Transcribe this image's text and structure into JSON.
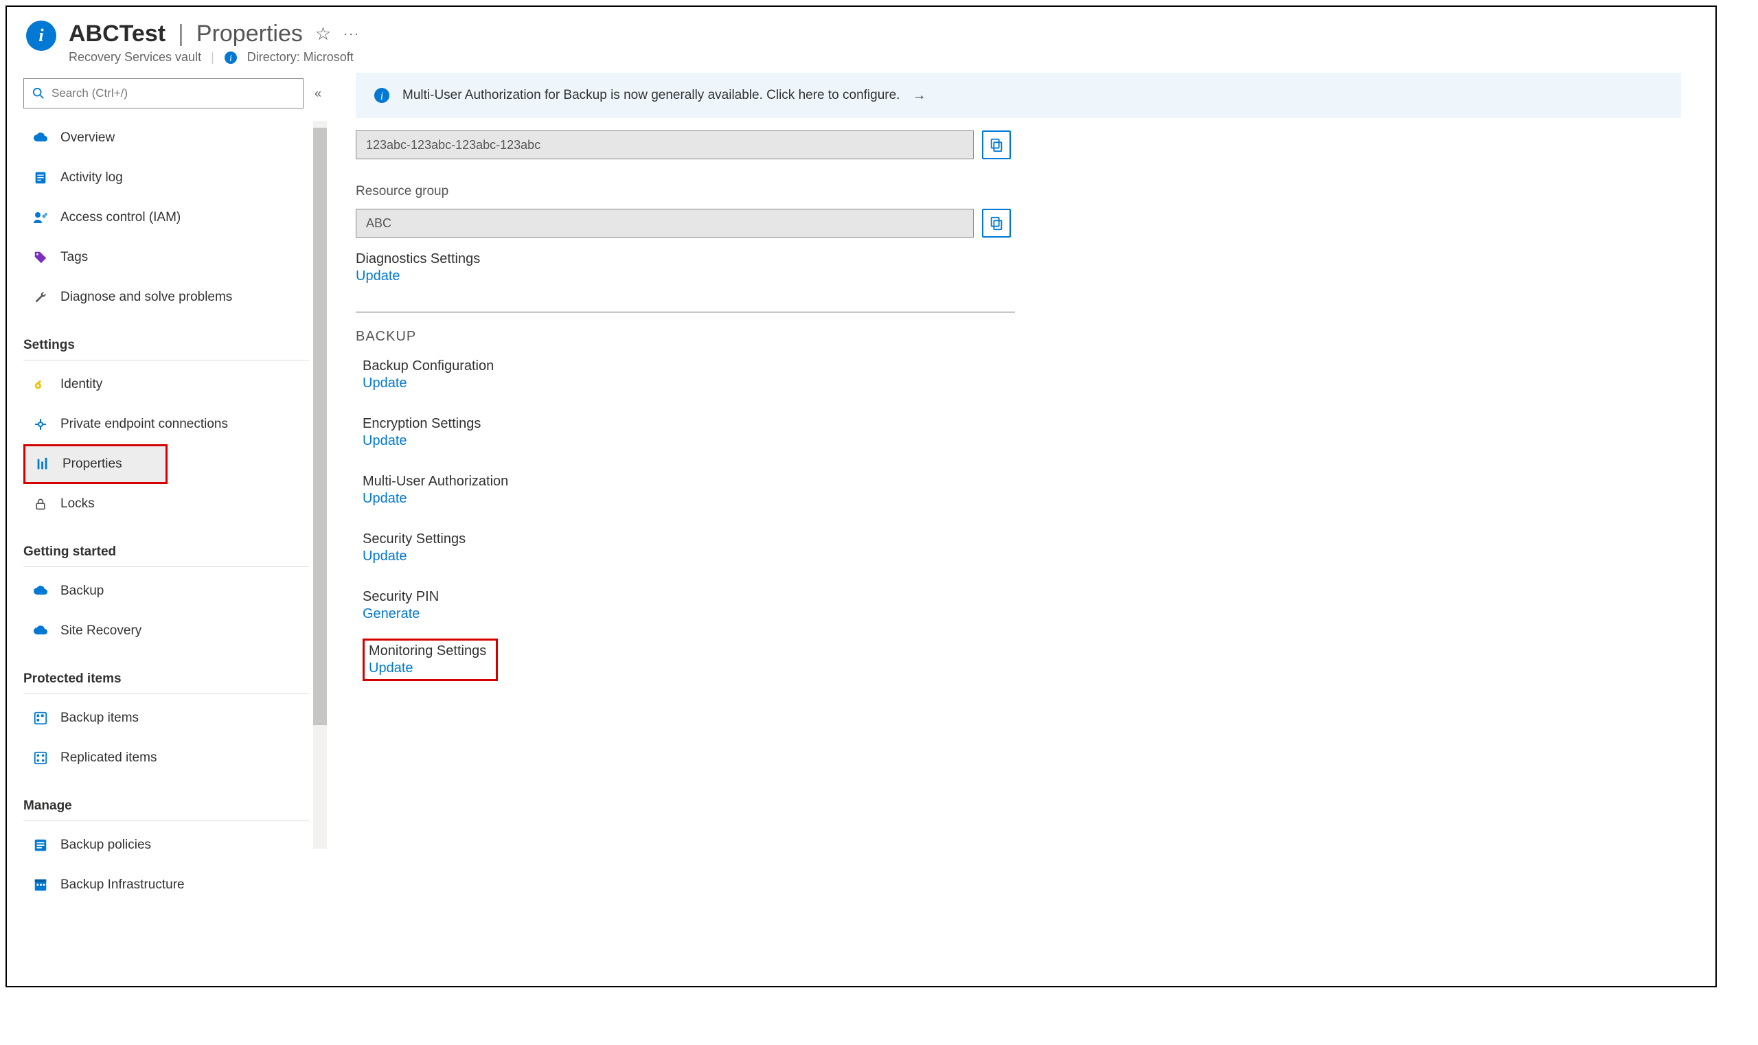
{
  "header": {
    "resource_name": "ABCTest",
    "page_name": "Properties",
    "subtitle_type": "Recovery Services vault",
    "directory_label": "Directory: Microsoft"
  },
  "sidebar": {
    "search_placeholder": "Search (Ctrl+/)",
    "groups": [
      {
        "section": null,
        "items": [
          {
            "icon": "cloud-blue",
            "label": "Overview"
          },
          {
            "icon": "log",
            "label": "Activity log"
          },
          {
            "icon": "iam",
            "label": "Access control (IAM)"
          },
          {
            "icon": "tag",
            "label": "Tags"
          },
          {
            "icon": "wrench",
            "label": "Diagnose and solve problems"
          }
        ]
      },
      {
        "section": "Settings",
        "items": [
          {
            "icon": "key-yellow",
            "label": "Identity"
          },
          {
            "icon": "endpoint",
            "label": "Private endpoint connections"
          },
          {
            "icon": "bars",
            "label": "Properties",
            "selected": true,
            "highlight": true
          },
          {
            "icon": "lock",
            "label": "Locks"
          }
        ]
      },
      {
        "section": "Getting started",
        "items": [
          {
            "icon": "cloud-blue",
            "label": "Backup"
          },
          {
            "icon": "cloud-blue",
            "label": "Site Recovery"
          }
        ]
      },
      {
        "section": "Protected items",
        "items": [
          {
            "icon": "grid-backup",
            "label": "Backup items"
          },
          {
            "icon": "grid-repl",
            "label": "Replicated items"
          }
        ]
      },
      {
        "section": "Manage",
        "items": [
          {
            "icon": "grid-policy",
            "label": "Backup policies"
          },
          {
            "icon": "grid-infra",
            "label": "Backup Infrastructure"
          }
        ]
      }
    ]
  },
  "main": {
    "banner_text": "Multi-User Authorization for Backup is now generally available. Click here to configure.",
    "vault_id_value": "123abc-123abc-123abc-123abc",
    "rg_label": "Resource group",
    "rg_value": "ABC",
    "diag_label": "Diagnostics Settings",
    "diag_link": "Update",
    "backup_section": "BACKUP",
    "backup_items": [
      {
        "label": "Backup Configuration",
        "link": "Update"
      },
      {
        "label": "Encryption Settings",
        "link": "Update"
      },
      {
        "label": "Multi-User Authorization",
        "link": "Update"
      },
      {
        "label": "Security Settings",
        "link": "Update"
      },
      {
        "label": "Security PIN",
        "link": "Generate"
      },
      {
        "label": "Monitoring Settings",
        "link": "Update",
        "highlight": true
      }
    ]
  },
  "colors": {
    "link": "#0078d4",
    "highlight_border": "#d40000",
    "banner_bg": "#eef6fc"
  }
}
